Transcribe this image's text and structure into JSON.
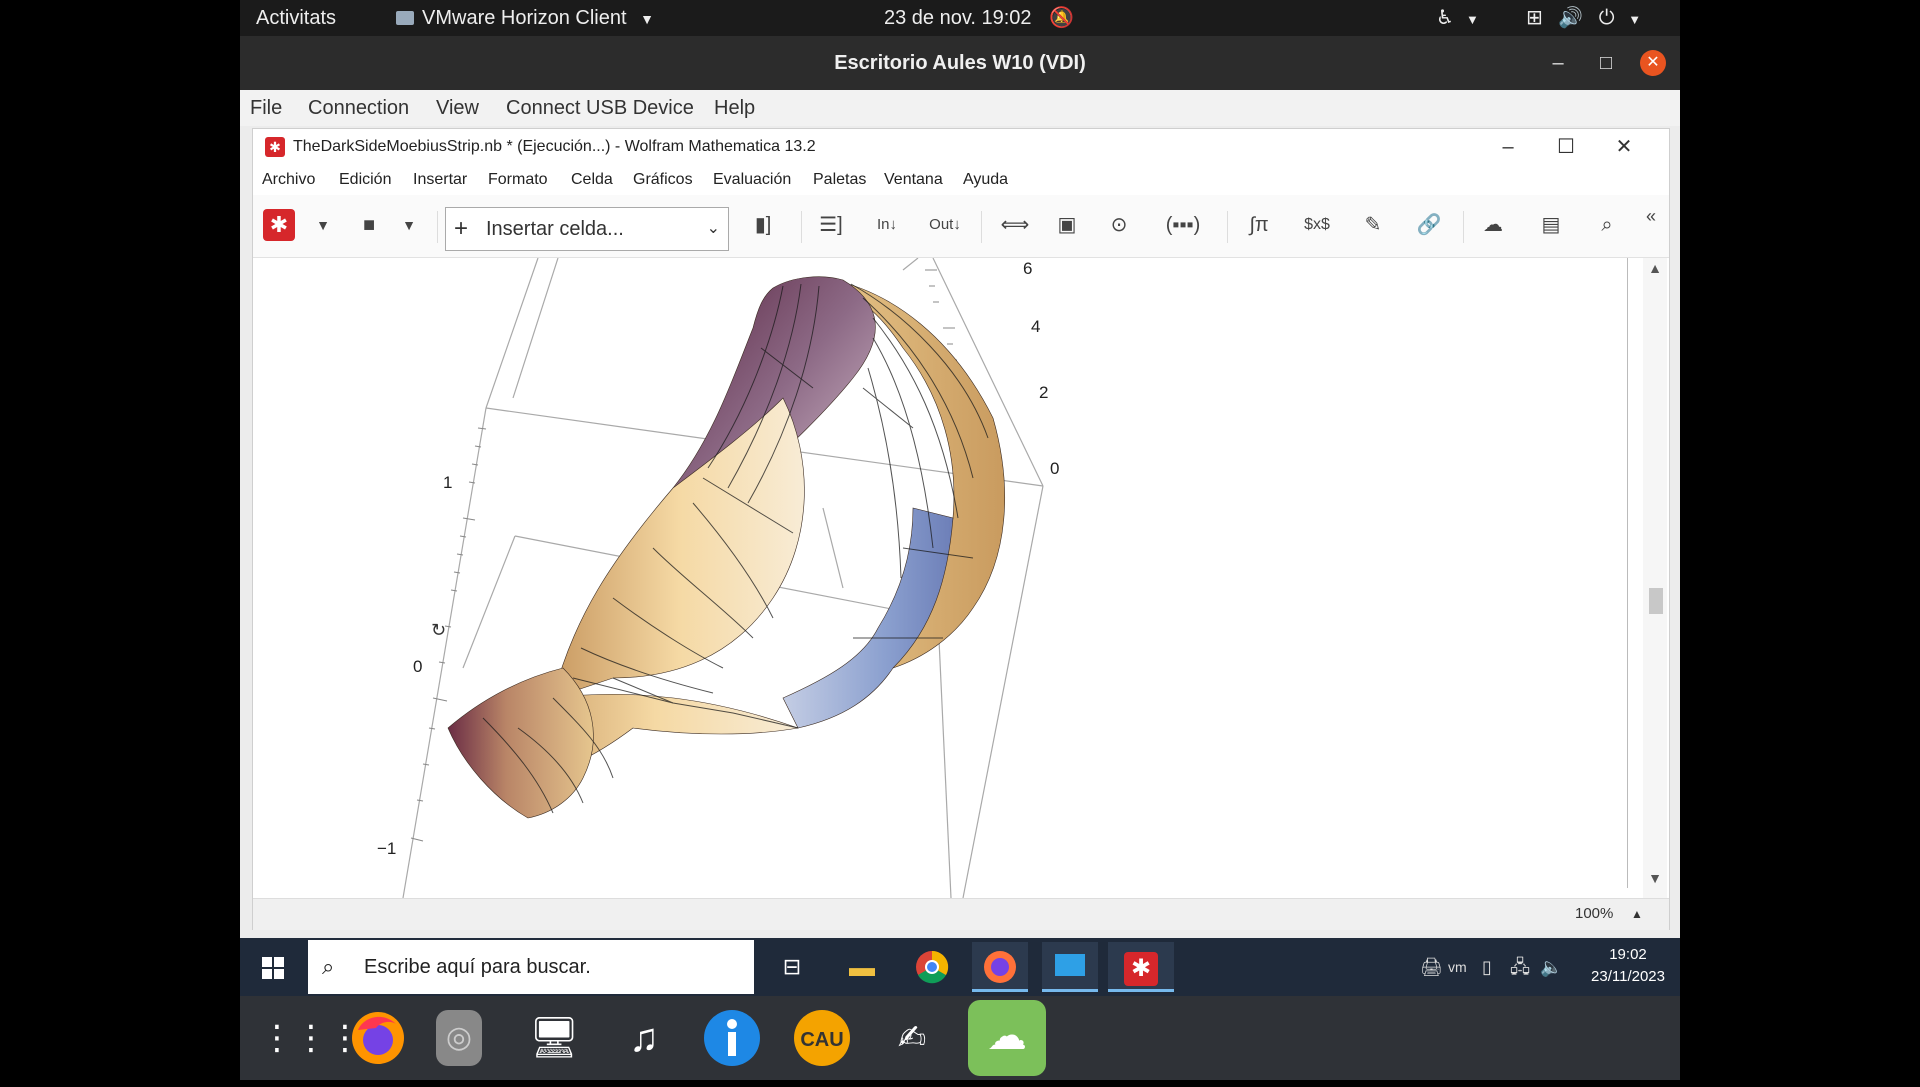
{
  "ubuntu_bar": {
    "activities": "Activitats",
    "app_name": "VMware Horizon Client",
    "datetime": "23 de nov.  19:02"
  },
  "vmware": {
    "title": "Escritorio Aules W10 (VDI)",
    "menu": [
      "File",
      "Connection",
      "View",
      "Connect USB Device",
      "Help"
    ]
  },
  "mathematica": {
    "title": "TheDarkSideMoebiusStrip.nb * (Ejecución...) - Wolfram Mathematica 13.2",
    "menu": [
      "Archivo",
      "Edición",
      "Insertar",
      "Formato",
      "Celda",
      "Gráficos",
      "Evaluación",
      "Paletas",
      "Ventana",
      "Ayuda"
    ],
    "toolbar": {
      "insert_cell": "Insertar celda..."
    },
    "zoom": "100%",
    "axis_ticks_right": [
      "6",
      "4",
      "2",
      "0"
    ],
    "axis_ticks_left": [
      "1",
      "0",
      "−1"
    ]
  },
  "windows_taskbar": {
    "search_placeholder": "Escribe aquí para buscar.",
    "time": "19:02",
    "date": "23/11/2023"
  },
  "colors": {
    "accent_ubuntu": "#e95420",
    "mathematica_red": "#d6272b",
    "taskbar": "#1f2a3a"
  }
}
